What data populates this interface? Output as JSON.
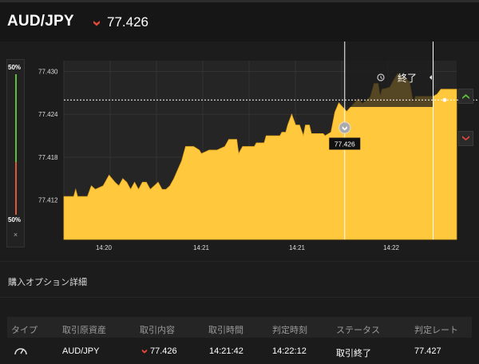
{
  "header": {
    "pair": "AUD/JPY",
    "price": "77.426",
    "direction_icon": "down-arrow-icon",
    "direction_color": "#e0473a"
  },
  "gauge": {
    "top_label": "50%",
    "bottom_label": "50%",
    "close_label": "×",
    "up_percent": 50,
    "down_percent": 50,
    "up_color": "#5fbf3a",
    "down_color": "#e0573a"
  },
  "chart": {
    "end_label": "終了",
    "current_price_label": "77.426",
    "area_color": "#ffc83d"
  },
  "chart_data": {
    "type": "area",
    "title": "",
    "xlabel": "",
    "ylabel": "",
    "y_ticks": [
      "77.430",
      "77.424",
      "77.418",
      "77.412"
    ],
    "x_ticks": [
      "14:20",
      "14:21",
      "14:21",
      "14:22"
    ],
    "ylim": [
      77.4065,
      77.4315
    ],
    "xlim": [
      0,
      100
    ],
    "current_price": 77.426,
    "entry_marker_x": 71.5,
    "end_marker_x": 94,
    "series": [
      {
        "values": [
          [
            0,
            77.4125
          ],
          [
            2.5,
            77.4125
          ],
          [
            3,
            77.4135
          ],
          [
            3.5,
            77.4125
          ],
          [
            6,
            77.4125
          ],
          [
            7,
            77.414
          ],
          [
            8,
            77.4135
          ],
          [
            10,
            77.414
          ],
          [
            11.5,
            77.4155
          ],
          [
            13,
            77.4145
          ],
          [
            14,
            77.414
          ],
          [
            15,
            77.415
          ],
          [
            16,
            77.4145
          ],
          [
            17,
            77.4135
          ],
          [
            18,
            77.4145
          ],
          [
            19,
            77.4135
          ],
          [
            20,
            77.4145
          ],
          [
            21,
            77.4145
          ],
          [
            22,
            77.4135
          ],
          [
            23,
            77.414
          ],
          [
            24,
            77.4145
          ],
          [
            25,
            77.4135
          ],
          [
            26,
            77.4135
          ],
          [
            27,
            77.414
          ],
          [
            28,
            77.415
          ],
          [
            30,
            77.4175
          ],
          [
            31,
            77.4195
          ],
          [
            33,
            77.4195
          ],
          [
            34.5,
            77.419
          ],
          [
            35,
            77.4185
          ],
          [
            37,
            77.419
          ],
          [
            39,
            77.419
          ],
          [
            41,
            77.4195
          ],
          [
            42,
            77.4205
          ],
          [
            44,
            77.4205
          ],
          [
            44.5,
            77.4185
          ],
          [
            45.5,
            77.4195
          ],
          [
            48.5,
            77.4195
          ],
          [
            49,
            77.42
          ],
          [
            51,
            77.42
          ],
          [
            51.5,
            77.421
          ],
          [
            55,
            77.421
          ],
          [
            55.5,
            77.4215
          ],
          [
            56.5,
            77.4215
          ],
          [
            57,
            77.4225
          ],
          [
            58,
            77.424
          ],
          [
            59,
            77.4225
          ],
          [
            60,
            77.4225
          ],
          [
            61,
            77.421
          ],
          [
            61.5,
            77.4225
          ],
          [
            62.5,
            77.4225
          ],
          [
            63,
            77.4213
          ],
          [
            65,
            77.4213
          ],
          [
            66,
            77.4213
          ],
          [
            66.5,
            77.421
          ],
          [
            68,
            77.4215
          ],
          [
            69,
            77.4243
          ],
          [
            70,
            77.4256
          ],
          [
            72,
            77.4244
          ],
          [
            74,
            77.4256
          ],
          [
            75,
            77.4262
          ],
          [
            76,
            77.4255
          ],
          [
            78,
            77.4264
          ],
          [
            79,
            77.4283
          ],
          [
            80,
            77.4283
          ],
          [
            80.5,
            77.4265
          ],
          [
            81,
            77.4275
          ],
          [
            82,
            77.4276
          ],
          [
            83,
            77.4278
          ],
          [
            84,
            77.4288
          ],
          [
            85,
            77.4297
          ],
          [
            86,
            77.4292
          ],
          [
            87,
            77.429
          ],
          [
            88,
            77.4285
          ],
          [
            89,
            77.4255
          ],
          [
            89.5,
            77.4265
          ],
          [
            94,
            77.4265
          ],
          [
            95,
            77.4268
          ],
          [
            96,
            77.4275
          ],
          [
            100,
            77.4275
          ]
        ]
      }
    ],
    "grid": true
  },
  "buttons": {
    "up_icon": "chevron-up-icon",
    "down_icon": "chevron-down-icon",
    "up_color": "#5fbf3a",
    "down_color": "#e0473a"
  },
  "section": {
    "title": "購入オプション詳細"
  },
  "table": {
    "headers": [
      "タイプ",
      "取引原資産",
      "取引内容",
      "取引時間",
      "判定時刻",
      "ステータス",
      "判定レート"
    ],
    "rows": [
      {
        "type_icon": "gauge-icon",
        "asset": "AUD/JPY",
        "content_direction_icon": "down-arrow-icon",
        "content": "77.426",
        "trade_time": "14:21:42",
        "judge_time": "14:22:12",
        "status": "取引終了",
        "judge_rate": "77.427"
      }
    ]
  }
}
